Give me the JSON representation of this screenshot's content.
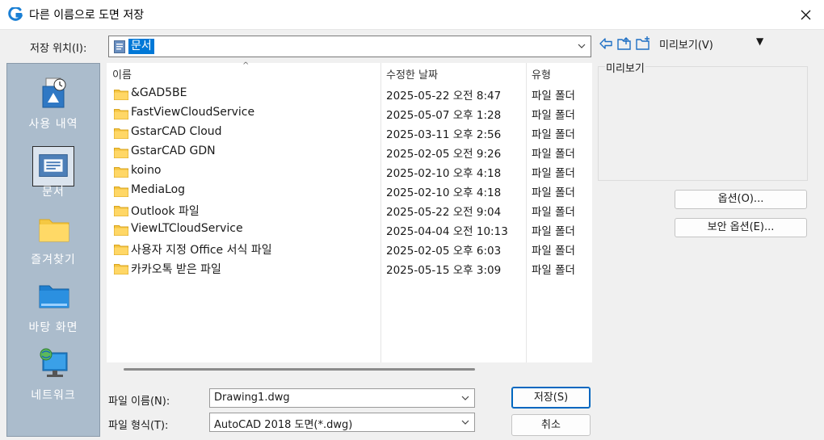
{
  "window": {
    "title": "다른 이름으로 도면 저장"
  },
  "location": {
    "label": "저장 위치(I):",
    "value": "문서"
  },
  "toolbar": {
    "views_label": "미리보기(V)",
    "views_arrow": "▼"
  },
  "places": [
    {
      "label": "사용 내역",
      "icon": "recent-icon"
    },
    {
      "label": "문서",
      "icon": "documents-icon",
      "selected": true
    },
    {
      "label": "즐겨찾기",
      "icon": "favorites-folder-icon"
    },
    {
      "label": "바탕 화면",
      "icon": "desktop-icon"
    },
    {
      "label": "네트워크",
      "icon": "network-icon"
    }
  ],
  "columns": {
    "name": "이름",
    "date": "수정한 날짜",
    "type": "유형",
    "sort_indicator": "^"
  },
  "files": [
    {
      "name": "&GAD5BE",
      "date": "2025-05-22 오전 8:47",
      "type": "파일 폴더"
    },
    {
      "name": "FastViewCloudService",
      "date": "2025-05-07 오후 1:28",
      "type": "파일 폴더"
    },
    {
      "name": "GstarCAD Cloud",
      "date": "2025-03-11 오후 2:56",
      "type": "파일 폴더"
    },
    {
      "name": "GstarCAD GDN",
      "date": "2025-02-05 오전 9:26",
      "type": "파일 폴더"
    },
    {
      "name": "koino",
      "date": "2025-02-10 오후 4:18",
      "type": "파일 폴더"
    },
    {
      "name": "MediaLog",
      "date": "2025-02-10 오후 4:18",
      "type": "파일 폴더"
    },
    {
      "name": "Outlook 파일",
      "date": "2025-05-22 오전 9:04",
      "type": "파일 폴더"
    },
    {
      "name": "ViewLTCloudService",
      "date": "2025-04-04 오전 10:13",
      "type": "파일 폴더"
    },
    {
      "name": "사용자 지정 Office 서식 파일",
      "date": "2025-02-05 오후 6:03",
      "type": "파일 폴더"
    },
    {
      "name": "카카오톡 받은 파일",
      "date": "2025-05-15 오후 3:09",
      "type": "파일 폴더"
    }
  ],
  "preview": {
    "label": "미리보기"
  },
  "buttons": {
    "options": "옵션(O)...",
    "security_options": "보안 옵션(E)...",
    "save": "저장(S)",
    "cancel": "취소"
  },
  "filename": {
    "label": "파일 이름(N):",
    "value": "Drawing1.dwg"
  },
  "filetype": {
    "label": "파일 형식(T):",
    "value": "AutoCAD 2018 도면(*.dwg)"
  },
  "colors": {
    "accent": "#0078d7",
    "places_bg": "#abbccc",
    "folder": "#f8d775"
  }
}
